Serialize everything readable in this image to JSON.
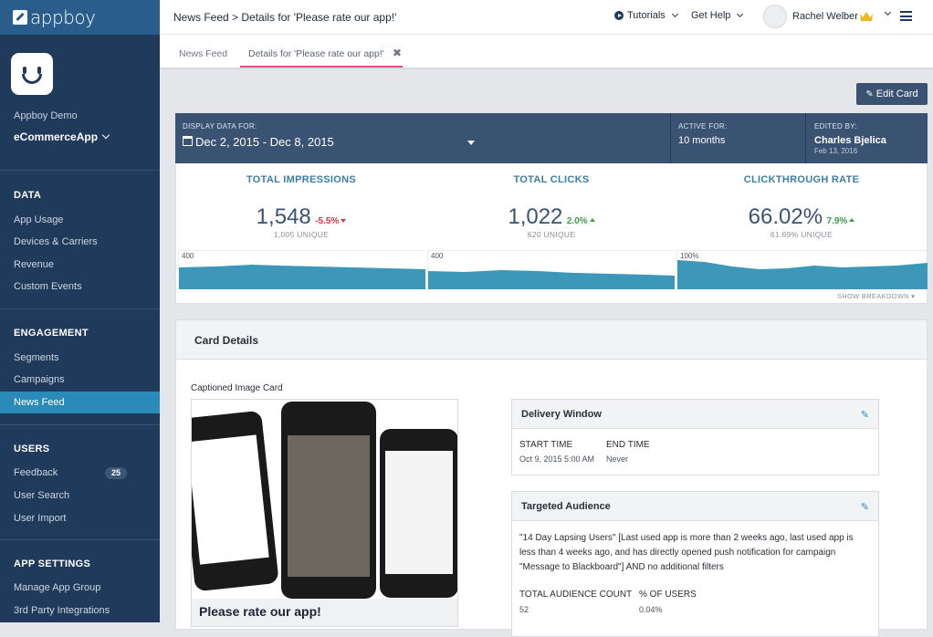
{
  "sidebar": {
    "logo_text": "appboy",
    "company": "Appboy Demo",
    "app_name": "eCommerceApp",
    "sections": {
      "data": {
        "title": "DATA",
        "items": [
          "App Usage",
          "Devices & Carriers",
          "Revenue",
          "Custom Events"
        ]
      },
      "engagement": {
        "title": "ENGAGEMENT",
        "items": [
          "Segments",
          "Campaigns",
          "News Feed"
        ]
      },
      "users": {
        "title": "USERS",
        "items": [
          "Feedback",
          "User Search",
          "User Import"
        ],
        "feedback_badge": "25"
      },
      "app_settings": {
        "title": "APP SETTINGS",
        "items": [
          "Manage App Group",
          "3rd Party Integrations"
        ]
      }
    },
    "active_item": "News Feed"
  },
  "topbar": {
    "title": "News Feed > Details for 'Please rate our app!'",
    "tutorials": "Tutorials",
    "help": "Get Help",
    "user": "Rachel Welber"
  },
  "tabs": {
    "news_feed": "News Feed",
    "details": "Details for 'Please rate our app!'",
    "close": "✖"
  },
  "edit_button": "Edit Card",
  "stats_header": {
    "display_label": "DISPLAY DATA FOR:",
    "date_range": "Dec 2, 2015 - Dec 8, 2015",
    "active_label": "ACTIVE FOR:",
    "active_value": "10 months",
    "edited_label": "EDITED BY:",
    "edited_by": "Charles Bjelica",
    "edited_date": "Feb 13, 2016"
  },
  "stats": {
    "impressions": {
      "title": "TOTAL IMPRESSIONS",
      "value": "1,548",
      "change": "-5.5%",
      "unique": "1,005 UNIQUE",
      "axis_max": "400"
    },
    "clicks": {
      "title": "TOTAL CLICKS",
      "value": "1,022",
      "change": "2.0%",
      "unique": "620 UNIQUE",
      "axis_max": "400"
    },
    "ctr": {
      "title": "CLICKTHROUGH RATE",
      "value": "66.02%",
      "change": "7.9%",
      "unique": "61.69% UNIQUE",
      "axis_max": "100%"
    },
    "breakdown": "SHOW BREAKDOWN ▾"
  },
  "colors": {
    "accent": "#2a8ab8",
    "navy": "#3a5373",
    "sidebar": "#1f3a5a",
    "tab_underline": "#dd4f85",
    "up": "#3aa04a",
    "down": "#e0333a",
    "spark": "#3d97b8"
  },
  "card_details": {
    "title": "Card Details",
    "card_type": "Captioned Image Card",
    "preview_title": "Please rate our app!",
    "delivery": {
      "title": "Delivery Window",
      "start_label": "START TIME",
      "start_value": "Oct 9, 2015 5:00 AM",
      "end_label": "END TIME",
      "end_value": "Never"
    },
    "audience": {
      "title": "Targeted Audience",
      "description": "\"14 Day Lapsing Users\" [Last used app is more than 2 weeks ago, last used app is less than 4 weeks ago, and has directly opened push notification for campaign \"Message to Blackboard\"] AND no additional filters",
      "count_label": "TOTAL AUDIENCE COUNT",
      "count_value": "52",
      "pct_label": "% OF USERS",
      "pct_value": "0.04%"
    }
  }
}
